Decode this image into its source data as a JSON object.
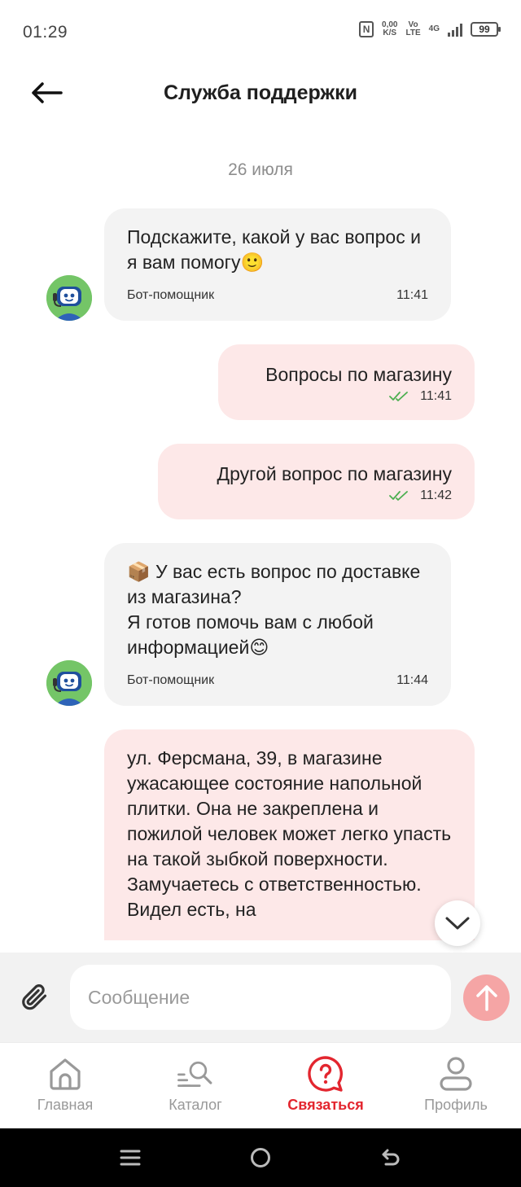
{
  "status_bar": {
    "time": "01:29",
    "net_speed_value": "0,00",
    "net_speed_unit": "K/S",
    "volte_top": "Vo",
    "volte_bottom": "LTE",
    "network": "4G",
    "battery": "99"
  },
  "header": {
    "title": "Служба поддержки"
  },
  "chat": {
    "date": "26 июля",
    "messages": [
      {
        "from": "bot",
        "text": "Подскажите, какой у вас вопрос и я вам помогу🙂",
        "sender": "Бот-помощник",
        "time": "11:41"
      },
      {
        "from": "user",
        "text": "Вопросы по магазину",
        "time": "11:41",
        "read": true
      },
      {
        "from": "user",
        "text": "Другой вопрос по магазину",
        "time": "11:42",
        "read": true
      },
      {
        "from": "bot",
        "text": "📦 У вас есть вопрос по доставке из магазина?\nЯ готов помочь вам с любой информацией😊",
        "sender": "Бот-помощник",
        "time": "11:44"
      },
      {
        "from": "user",
        "text": "ул. Ферсмана, 39, в магазине ужасающее состояние напольной плитки. Она не закреплена и пожилой человек может легко упасть на такой зыбкой поверхности. Замучаетесь с ответственностью. Видел есть, на"
      }
    ]
  },
  "composer": {
    "placeholder": "Сообщение"
  },
  "bottom_nav": {
    "items": [
      {
        "label": "Главная",
        "icon": "home-icon",
        "active": false
      },
      {
        "label": "Каталог",
        "icon": "catalog-search-icon",
        "active": false
      },
      {
        "label": "Связаться",
        "icon": "support-chat-icon",
        "active": true
      },
      {
        "label": "Профиль",
        "icon": "profile-icon",
        "active": false
      }
    ]
  },
  "colors": {
    "accent": "#e3262f",
    "bot_bubble": "#f3f3f3",
    "user_bubble": "#fde8e8",
    "send_button": "#f5a5a5",
    "read_check": "#4caf50"
  }
}
